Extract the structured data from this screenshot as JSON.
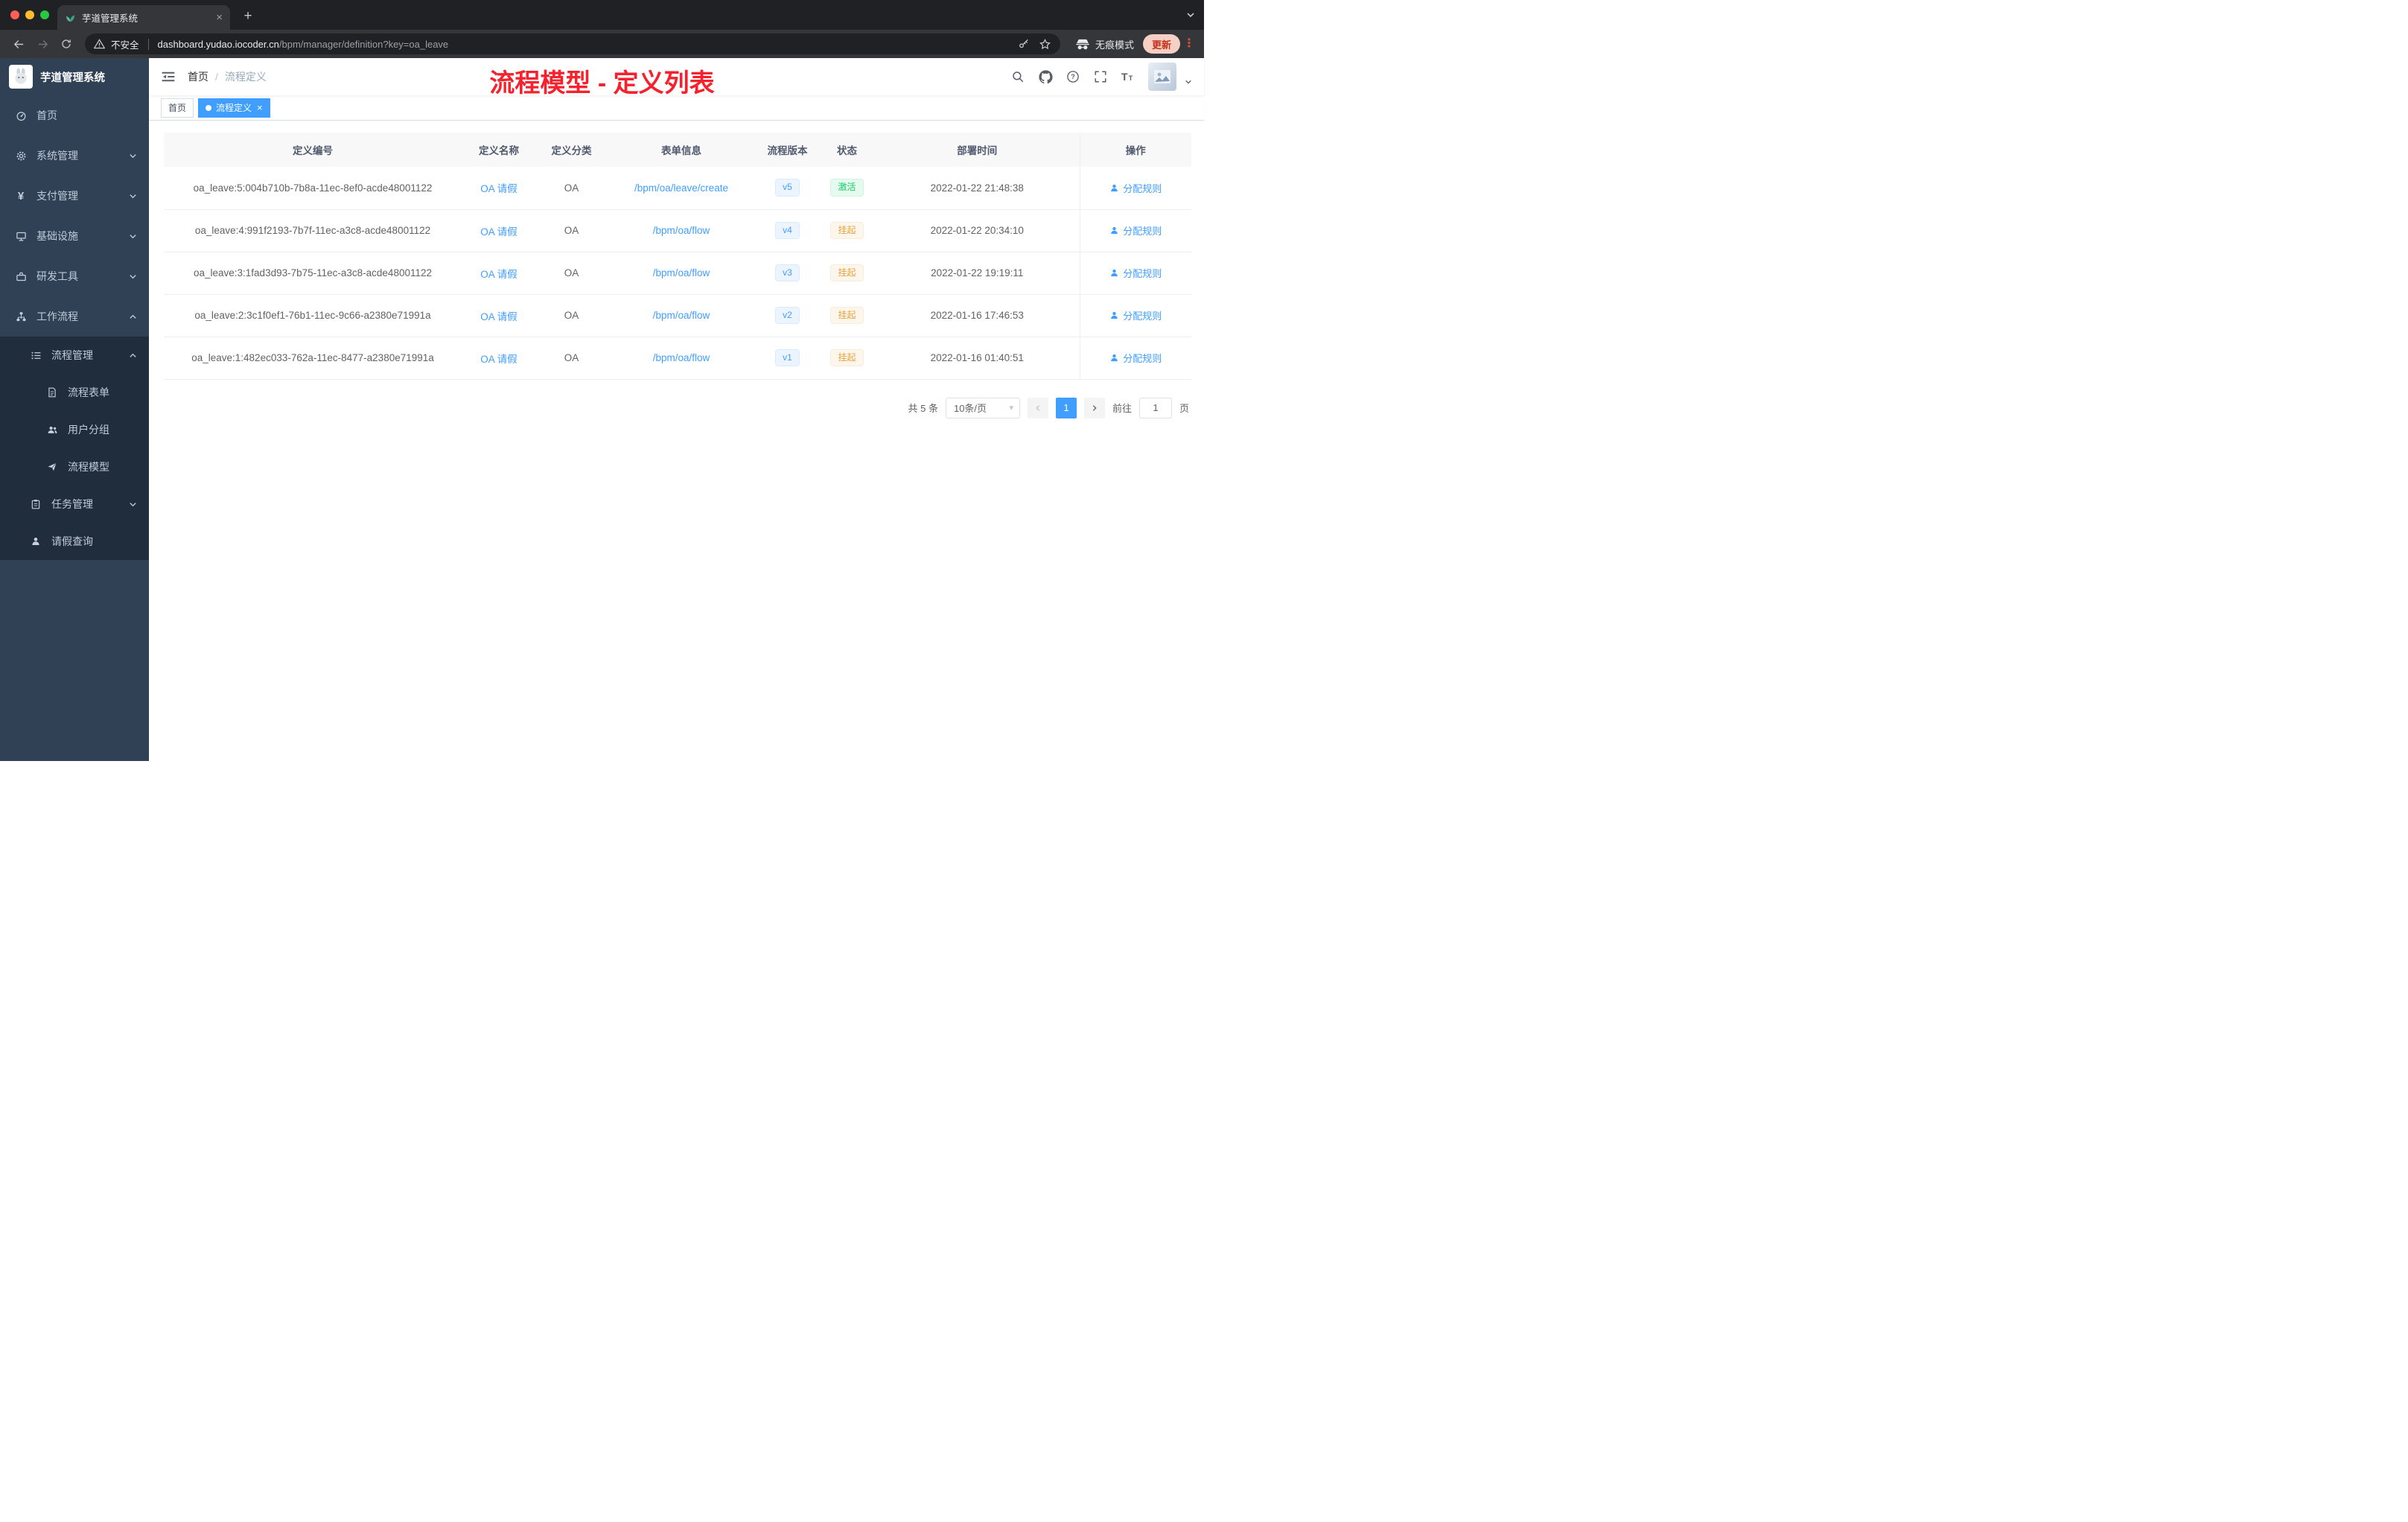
{
  "browser": {
    "tab_title": "芋道管理系统",
    "not_secure": "不安全",
    "url_host": "dashboard.yudao.iocoder.cn",
    "url_path": "/bpm/manager/definition?key=oa_leave",
    "incognito_label": "无痕模式",
    "update_label": "更新"
  },
  "sidebar": {
    "title": "芋道管理系统",
    "items": {
      "home": "首页",
      "system": "系统管理",
      "payment": "支付管理",
      "infrastructure": "基础设施",
      "devtools": "研发工具",
      "workflow": "工作流程",
      "process_mgmt": "流程管理",
      "process_form": "流程表单",
      "user_group": "用户分组",
      "process_model": "流程模型",
      "task_mgmt": "任务管理",
      "leave_query": "请假查询"
    }
  },
  "header": {
    "breadcrumb": {
      "home": "首页",
      "sep": "/",
      "current": "流程定义"
    }
  },
  "tags": {
    "home": "首页",
    "active": "流程定义",
    "close": "×"
  },
  "annotation": "流程模型 - 定义列表",
  "table": {
    "headers": {
      "id": "定义编号",
      "name": "定义名称",
      "category": "定义分类",
      "form": "表单信息",
      "version": "流程版本",
      "status": "状态",
      "deploy_time": "部署时间",
      "actions": "操作"
    },
    "action_label": "分配规则",
    "rows": [
      {
        "id": "oa_leave:5:004b710b-7b8a-11ec-8ef0-acde48001122",
        "name": "OA 请假",
        "category": "OA",
        "form": "/bpm/oa/leave/create",
        "version": "v5",
        "status": "激活",
        "deploy_time": "2022-01-22 21:48:38"
      },
      {
        "id": "oa_leave:4:991f2193-7b7f-11ec-a3c8-acde48001122",
        "name": "OA 请假",
        "category": "OA",
        "form": "/bpm/oa/flow",
        "version": "v4",
        "status": "挂起",
        "deploy_time": "2022-01-22 20:34:10"
      },
      {
        "id": "oa_leave:3:1fad3d93-7b75-11ec-a3c8-acde48001122",
        "name": "OA 请假",
        "category": "OA",
        "form": "/bpm/oa/flow",
        "version": "v3",
        "status": "挂起",
        "deploy_time": "2022-01-22 19:19:11"
      },
      {
        "id": "oa_leave:2:3c1f0ef1-76b1-11ec-9c66-a2380e71991a",
        "name": "OA 请假",
        "category": "OA",
        "form": "/bpm/oa/flow",
        "version": "v2",
        "status": "挂起",
        "deploy_time": "2022-01-16 17:46:53"
      },
      {
        "id": "oa_leave:1:482ec033-762a-11ec-8477-a2380e71991a",
        "name": "OA 请假",
        "category": "OA",
        "form": "/bpm/oa/flow",
        "version": "v1",
        "status": "挂起",
        "deploy_time": "2022-01-16 01:40:51"
      }
    ]
  },
  "pagination": {
    "total": "共 5 条",
    "page_size": "10条/页",
    "page": "1",
    "goto_label": "前往",
    "goto_value": "1",
    "page_unit": "页"
  },
  "colors": {
    "accent": "#409eff",
    "annotation_red": "#f5222d",
    "status_active_green": "#13ce66",
    "status_suspend_orange": "#e6a23c",
    "sidebar_bg": "#304156",
    "submenu_bg": "#1f2d3d",
    "update_chip": "#c5301c"
  }
}
